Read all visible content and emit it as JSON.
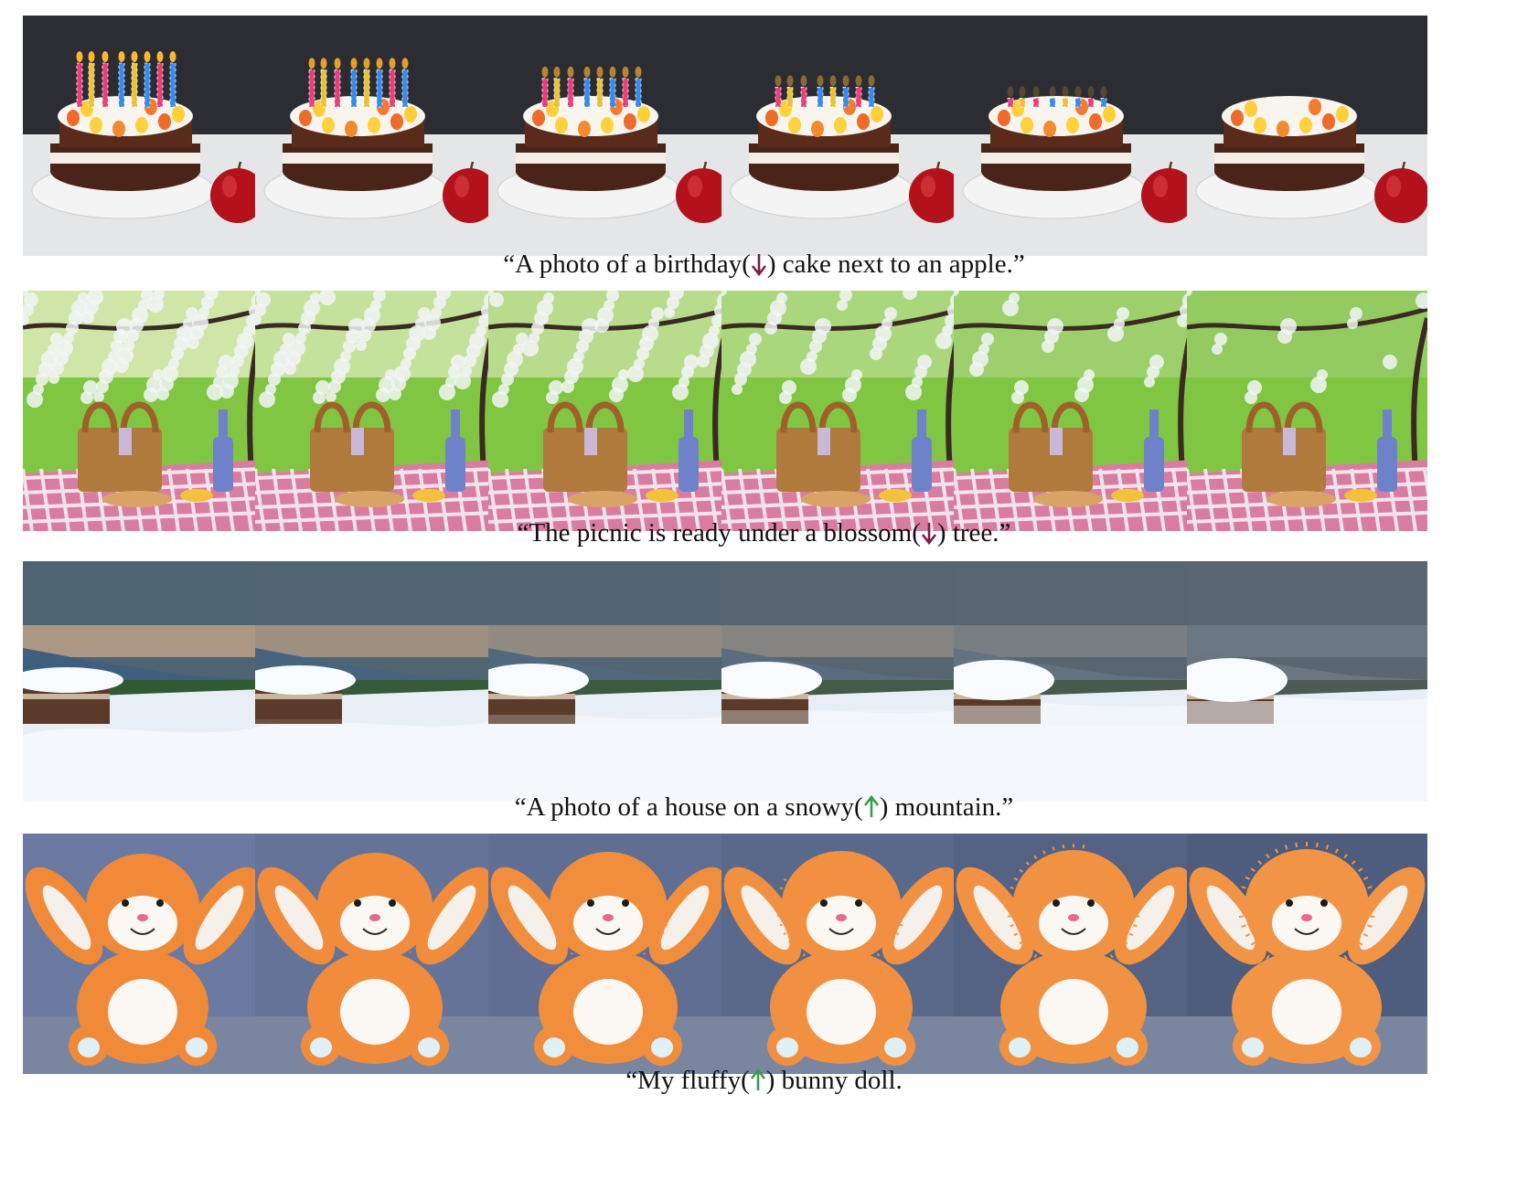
{
  "colors": {
    "down_arrow": "#7a1f3d",
    "up_arrow": "#3a9a4c",
    "caption_text": "#111111"
  },
  "figure_rows": [
    {
      "id": "cake",
      "subject_icon": "birthday-cake-image",
      "caption": {
        "before": "“A photo of a birthday(",
        "arrow": "down-arrow-icon",
        "after": ") cake next to an apple.”"
      },
      "tiles": [
        {
          "step": 1,
          "candle_strength": 1.0
        },
        {
          "step": 2,
          "candle_strength": 0.85
        },
        {
          "step": 3,
          "candle_strength": 0.65
        },
        {
          "step": 4,
          "candle_strength": 0.45
        },
        {
          "step": 5,
          "candle_strength": 0.2
        },
        {
          "step": 6,
          "candle_strength": 0.0
        }
      ]
    },
    {
      "id": "picnic",
      "subject_icon": "picnic-basket-image",
      "caption": {
        "before": "“The picnic is ready under a blossom(",
        "arrow": "down-arrow-icon",
        "after": ") tree.”"
      },
      "tiles": [
        {
          "step": 1,
          "blossom_strength": 1.0
        },
        {
          "step": 2,
          "blossom_strength": 0.85
        },
        {
          "step": 3,
          "blossom_strength": 0.65
        },
        {
          "step": 4,
          "blossom_strength": 0.45
        },
        {
          "step": 5,
          "blossom_strength": 0.25
        },
        {
          "step": 6,
          "blossom_strength": 0.1
        }
      ]
    },
    {
      "id": "snowy",
      "subject_icon": "snowy-house-image",
      "caption": {
        "before": "“A photo of a house on a snowy(",
        "arrow": "up-arrow-icon",
        "after": ") mountain.”"
      },
      "tiles": [
        {
          "step": 1,
          "snow_strength": 0.0
        },
        {
          "step": 2,
          "snow_strength": 0.2
        },
        {
          "step": 3,
          "snow_strength": 0.4
        },
        {
          "step": 4,
          "snow_strength": 0.6
        },
        {
          "step": 5,
          "snow_strength": 0.8
        },
        {
          "step": 6,
          "snow_strength": 1.0
        }
      ]
    },
    {
      "id": "bunny",
      "subject_icon": "bunny-doll-image",
      "caption": {
        "before": "“My fluffy(",
        "arrow": "up-arrow-icon",
        "after": ") bunny doll."
      },
      "tiles": [
        {
          "step": 1,
          "fluff_strength": 0.0
        },
        {
          "step": 2,
          "fluff_strength": 0.2
        },
        {
          "step": 3,
          "fluff_strength": 0.4
        },
        {
          "step": 4,
          "fluff_strength": 0.6
        },
        {
          "step": 5,
          "fluff_strength": 0.8
        },
        {
          "step": 6,
          "fluff_strength": 1.0
        }
      ]
    }
  ]
}
